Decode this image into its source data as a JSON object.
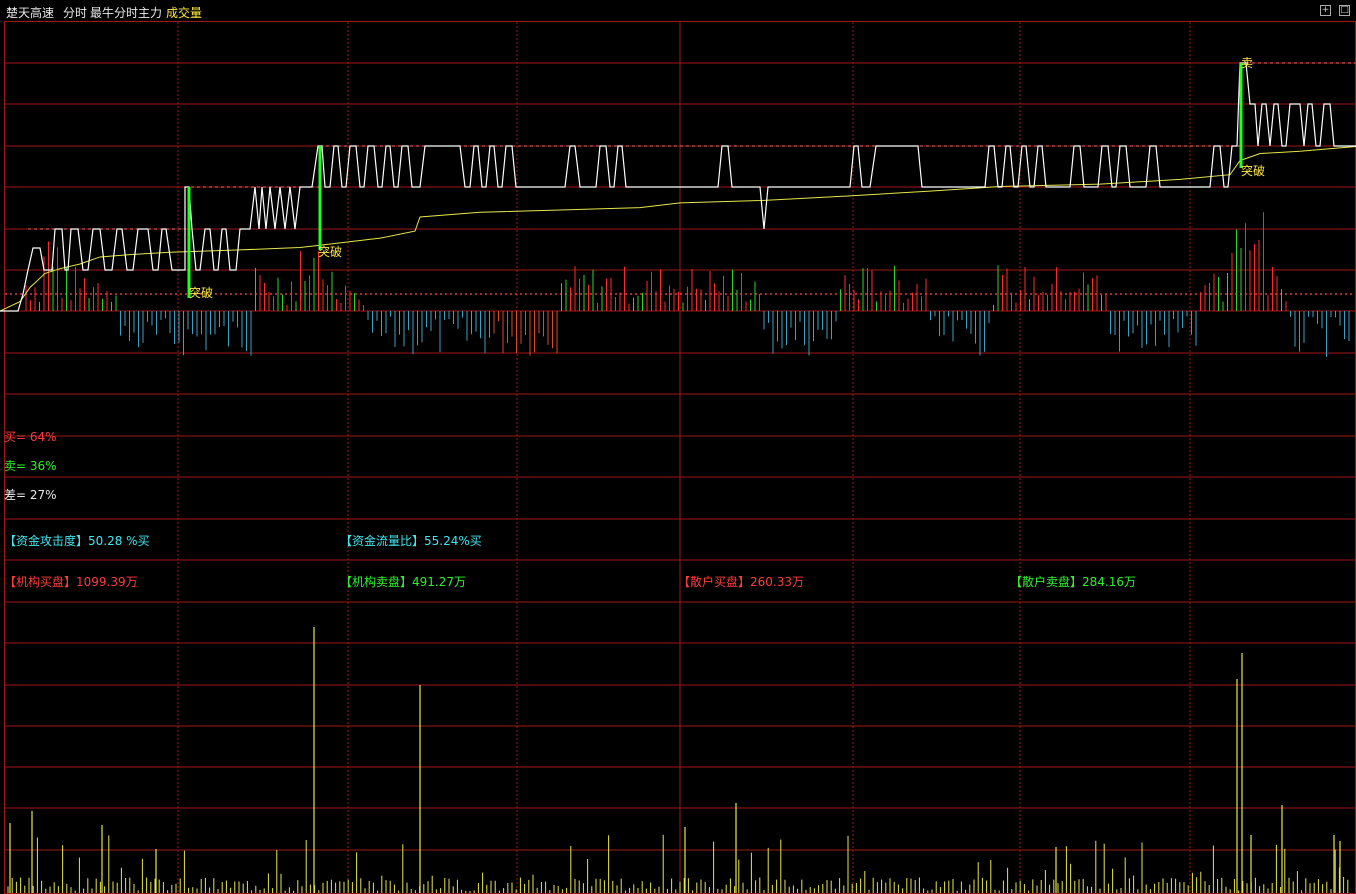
{
  "header": {
    "stock_name": "楚天高速",
    "mode": "分时",
    "indicator": "最牛分时主力",
    "volume_label": "成交量",
    "icon_restore": "restore-icon",
    "icon_maximize": "maximize-icon"
  },
  "colors": {
    "grid": "#a01818",
    "dashed_grid": "#8a1414",
    "price_line": "#ffffff",
    "avg_line": "#e6e64a",
    "buy": "#ff2a2a",
    "sell": "#2ad42a",
    "neg_bar": "#3aa0c0",
    "signal_bar": "#22ff22",
    "volume": "#e6e64a",
    "signal_text": "#ffe84a"
  },
  "signals": [
    {
      "label": "突破",
      "type": "breakout"
    },
    {
      "label": "突破",
      "type": "breakout"
    },
    {
      "label": "卖",
      "type": "sell"
    },
    {
      "label": "突破",
      "type": "breakout"
    }
  ],
  "ratios": {
    "buy": "买= 64%",
    "sell": "卖= 36%",
    "diff": "差= 27%"
  },
  "metrics": {
    "attack_label": "【资金攻击度】",
    "attack_value": "50.28 %买",
    "flow_label": "【资金流量比】",
    "flow_value": "55.24%买",
    "inst_buy_label": "【机构买盘】",
    "inst_buy_value": "1099.39万",
    "inst_sell_label": "【机构卖盘】",
    "inst_sell_value": "491.27万",
    "retail_buy_label": "【散户买盘】",
    "retail_buy_value": "260.33万",
    "retail_sell_label": "【散户卖盘】",
    "retail_sell_value": "284.16万"
  },
  "chart_data": {
    "type": "line",
    "title": "最牛分时主力",
    "price_levels": [
      0,
      1,
      2,
      3,
      4,
      5,
      6
    ],
    "price_series": [
      {
        "name": "price",
        "points": [
          [
            0,
            0
          ],
          [
            18,
            0
          ],
          [
            23,
            1
          ],
          [
            28,
            2
          ],
          [
            33,
            3
          ],
          [
            40,
            3
          ],
          [
            44,
            4
          ],
          [
            52,
            4
          ],
          [
            55,
            5
          ],
          [
            62,
            5
          ],
          [
            65,
            4
          ],
          [
            68,
            4
          ],
          [
            71,
            5
          ],
          [
            78,
            5
          ],
          [
            83,
            4
          ],
          [
            88,
            4
          ],
          [
            93,
            5
          ],
          [
            100,
            5
          ],
          [
            105,
            4
          ],
          [
            112,
            4
          ],
          [
            117,
            5
          ],
          [
            122,
            5
          ],
          [
            127,
            4
          ],
          [
            133,
            4
          ],
          [
            138,
            5
          ],
          [
            148,
            5
          ],
          [
            153,
            4
          ],
          [
            158,
            4
          ],
          [
            162,
            5
          ],
          [
            166,
            5
          ],
          [
            172,
            4
          ],
          [
            180,
            4
          ],
          [
            185,
            4
          ],
          [
            185,
            6
          ],
          [
            189,
            6
          ],
          [
            192,
            5
          ],
          [
            196,
            4
          ],
          [
            200,
            4
          ],
          [
            205,
            5
          ],
          [
            210,
            5
          ],
          [
            214,
            4
          ],
          [
            218,
            4
          ],
          [
            222,
            5
          ],
          [
            226,
            5
          ],
          [
            230,
            4
          ],
          [
            236,
            4
          ],
          [
            240,
            5
          ],
          [
            245,
            5
          ],
          [
            250,
            5
          ],
          [
            255,
            6
          ],
          [
            259,
            5
          ],
          [
            262,
            6
          ],
          [
            266,
            5
          ],
          [
            270,
            6
          ],
          [
            275,
            5
          ],
          [
            280,
            6
          ],
          [
            285,
            5
          ],
          [
            290,
            6
          ],
          [
            295,
            5
          ],
          [
            300,
            6
          ],
          [
            305,
            6
          ],
          [
            312,
            6
          ],
          [
            318,
            7
          ],
          [
            322,
            7
          ],
          [
            325,
            6
          ],
          [
            330,
            6
          ],
          [
            334,
            7
          ],
          [
            338,
            7
          ],
          [
            342,
            6
          ],
          [
            346,
            6
          ],
          [
            350,
            7
          ],
          [
            356,
            7
          ],
          [
            360,
            6
          ],
          [
            364,
            6
          ],
          [
            368,
            7
          ],
          [
            374,
            7
          ],
          [
            378,
            6
          ],
          [
            382,
            6
          ],
          [
            386,
            7
          ],
          [
            390,
            7
          ],
          [
            394,
            6
          ],
          [
            398,
            6
          ],
          [
            402,
            7
          ],
          [
            408,
            7
          ],
          [
            412,
            6
          ],
          [
            420,
            6
          ],
          [
            425,
            7
          ],
          [
            460,
            7
          ],
          [
            465,
            6
          ],
          [
            470,
            6
          ],
          [
            474,
            7
          ],
          [
            478,
            7
          ],
          [
            482,
            6
          ],
          [
            486,
            6
          ],
          [
            490,
            7
          ],
          [
            494,
            7
          ],
          [
            498,
            6
          ],
          [
            502,
            6
          ],
          [
            506,
            7
          ],
          [
            512,
            7
          ],
          [
            516,
            6
          ],
          [
            565,
            6
          ],
          [
            570,
            7
          ],
          [
            575,
            7
          ],
          [
            580,
            6
          ],
          [
            596,
            6
          ],
          [
            600,
            7
          ],
          [
            606,
            7
          ],
          [
            610,
            6
          ],
          [
            614,
            6
          ],
          [
            618,
            7
          ],
          [
            622,
            7
          ],
          [
            626,
            6
          ],
          [
            630,
            6
          ],
          [
            634,
            6
          ],
          [
            680,
            6
          ],
          [
            718,
            6
          ],
          [
            722,
            7
          ],
          [
            728,
            7
          ],
          [
            732,
            6
          ],
          [
            756,
            6
          ],
          [
            760,
            6
          ],
          [
            764,
            5
          ],
          [
            768,
            6
          ],
          [
            770,
            6
          ],
          [
            850,
            6
          ],
          [
            854,
            7
          ],
          [
            858,
            7
          ],
          [
            862,
            6
          ],
          [
            870,
            6
          ],
          [
            876,
            7
          ],
          [
            918,
            7
          ],
          [
            922,
            6
          ],
          [
            926,
            6
          ],
          [
            930,
            6
          ],
          [
            985,
            6
          ],
          [
            989,
            7
          ],
          [
            994,
            7
          ],
          [
            998,
            6
          ],
          [
            1002,
            6
          ],
          [
            1006,
            7
          ],
          [
            1010,
            7
          ],
          [
            1014,
            6
          ],
          [
            1018,
            6
          ],
          [
            1022,
            7
          ],
          [
            1026,
            7
          ],
          [
            1030,
            6
          ],
          [
            1034,
            6
          ],
          [
            1038,
            7
          ],
          [
            1042,
            7
          ],
          [
            1046,
            6
          ],
          [
            1070,
            6
          ],
          [
            1074,
            7
          ],
          [
            1080,
            7
          ],
          [
            1084,
            6
          ],
          [
            1098,
            6
          ],
          [
            1102,
            7
          ],
          [
            1108,
            7
          ],
          [
            1112,
            6
          ],
          [
            1116,
            6
          ],
          [
            1120,
            7
          ],
          [
            1126,
            7
          ],
          [
            1130,
            6
          ],
          [
            1146,
            6
          ],
          [
            1150,
            7
          ],
          [
            1156,
            7
          ],
          [
            1160,
            6
          ],
          [
            1210,
            6
          ],
          [
            1214,
            7
          ],
          [
            1220,
            7
          ],
          [
            1224,
            6
          ],
          [
            1228,
            6
          ],
          [
            1232,
            7
          ],
          [
            1237,
            7
          ],
          [
            1240,
            9
          ],
          [
            1246,
            9
          ],
          [
            1250,
            8
          ],
          [
            1255,
            8
          ],
          [
            1258,
            7
          ],
          [
            1262,
            8
          ],
          [
            1266,
            8
          ],
          [
            1270,
            7
          ],
          [
            1274,
            8
          ],
          [
            1278,
            8
          ],
          [
            1282,
            7
          ],
          [
            1286,
            7
          ],
          [
            1290,
            8
          ],
          [
            1300,
            8
          ],
          [
            1304,
            7
          ],
          [
            1308,
            8
          ],
          [
            1312,
            8
          ],
          [
            1316,
            7
          ],
          [
            1320,
            7
          ],
          [
            1324,
            8
          ],
          [
            1330,
            8
          ],
          [
            1334,
            7
          ],
          [
            1340,
            7
          ],
          [
            1356,
            7
          ]
        ]
      },
      {
        "name": "avg",
        "points": [
          [
            0,
            0
          ],
          [
            20,
            0.4
          ],
          [
            30,
            1
          ],
          [
            45,
            1.6
          ],
          [
            60,
            1.8
          ],
          [
            80,
            2
          ],
          [
            100,
            2.3
          ],
          [
            130,
            2.4
          ],
          [
            170,
            2.5
          ],
          [
            240,
            2.6
          ],
          [
            300,
            2.7
          ],
          [
            320,
            2.8
          ],
          [
            380,
            3.1
          ],
          [
            415,
            3.4
          ],
          [
            420,
            4
          ],
          [
            480,
            4.2
          ],
          [
            560,
            4.3
          ],
          [
            640,
            4.4
          ],
          [
            680,
            4.6
          ],
          [
            760,
            4.7
          ],
          [
            850,
            4.9
          ],
          [
            930,
            5.1
          ],
          [
            1000,
            5.3
          ],
          [
            1100,
            5.4
          ],
          [
            1180,
            5.6
          ],
          [
            1230,
            5.8
          ],
          [
            1240,
            6.4
          ],
          [
            1260,
            6.7
          ],
          [
            1300,
            6.8
          ],
          [
            1356,
            7.0
          ]
        ]
      }
    ],
    "xlabel": "",
    "ylabel": ""
  }
}
